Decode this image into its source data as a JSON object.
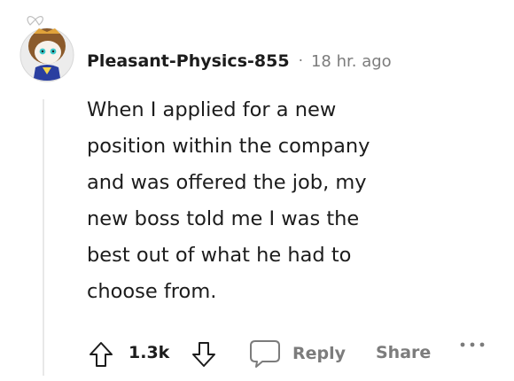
{
  "comment": {
    "username": "Pleasant-Physics-855",
    "separator": "·",
    "timestamp": "18 hr. ago",
    "body_lines": [
      "When I applied for a new",
      "position within the company",
      "and was offered the job, my",
      "new boss told me I was the",
      "best out of what he had to",
      "choose from."
    ]
  },
  "actions": {
    "score": "1.3k",
    "reply_label": "Reply",
    "share_label": "Share",
    "upvote_icon": "arrow-up-outline-icon",
    "downvote_icon": "arrow-down-outline-icon",
    "reply_icon": "speech-bubble-icon",
    "more_icon": "ellipsis-icon"
  },
  "colors": {
    "text_primary": "#1c1c1c",
    "text_secondary": "#7c7c7c",
    "thread_line": "#e8e8e8",
    "avatar_hair": "#8b5a2b",
    "avatar_eyes": "#3ec9c9",
    "avatar_outfit": "#2a3fa0"
  }
}
